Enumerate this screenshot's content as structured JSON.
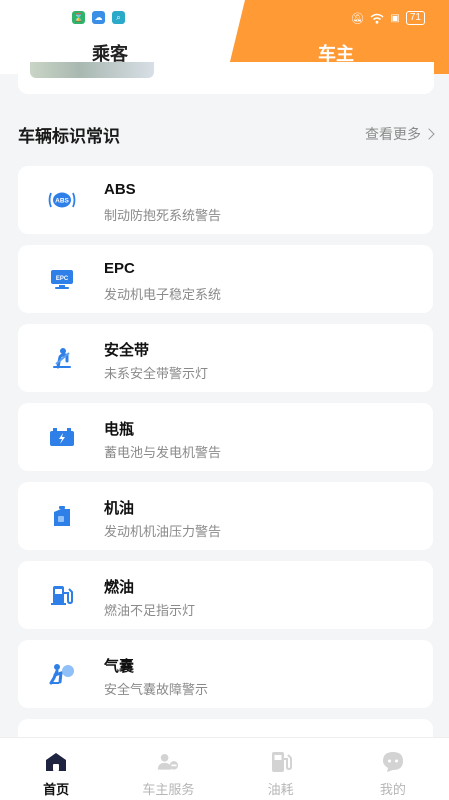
{
  "status_bar": {
    "battery": "71"
  },
  "tabs": [
    {
      "label": "乘客"
    },
    {
      "label": "车主"
    }
  ],
  "section": {
    "title": "车辆标识常识",
    "more_label": "查看更多"
  },
  "items": [
    {
      "name": "ABS",
      "desc": "制动防抱死系统警告",
      "icon": "abs-icon"
    },
    {
      "name": "EPC",
      "desc": "发动机电子稳定系统",
      "icon": "epc-icon"
    },
    {
      "name": "安全带",
      "desc": "未系安全带警示灯",
      "icon": "seatbelt-icon"
    },
    {
      "name": "电瓶",
      "desc": "蓄电池与发电机警告",
      "icon": "battery-icon"
    },
    {
      "name": "机油",
      "desc": "发动机机油压力警告",
      "icon": "oil-icon"
    },
    {
      "name": "燃油",
      "desc": "燃油不足指示灯",
      "icon": "fuel-icon"
    },
    {
      "name": "气囊",
      "desc": "安全气囊故障警示",
      "icon": "airbag-icon"
    }
  ],
  "nav": [
    {
      "label": "首页",
      "icon": "home-icon",
      "active": true
    },
    {
      "label": "车主服务",
      "icon": "owner-service-icon",
      "active": false
    },
    {
      "label": "油耗",
      "icon": "fuel-consumption-icon",
      "active": false
    },
    {
      "label": "我的",
      "icon": "profile-icon",
      "active": false
    }
  ],
  "colors": {
    "accent": "#ff9a34",
    "icon_blue": "#2f7fe8"
  }
}
